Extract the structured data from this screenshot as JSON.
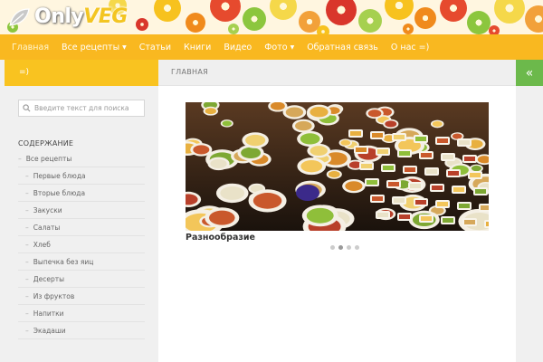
{
  "site": {
    "logo_part1": "Only",
    "logo_part2": "VEG"
  },
  "nav": {
    "items": [
      {
        "label": "Главная",
        "has_dropdown": false,
        "active": true
      },
      {
        "label": "Все рецепты",
        "has_dropdown": true,
        "active": false
      },
      {
        "label": "Статьи",
        "has_dropdown": false,
        "active": false
      },
      {
        "label": "Книги",
        "has_dropdown": false,
        "active": false
      },
      {
        "label": "Видео",
        "has_dropdown": false,
        "active": false
      },
      {
        "label": "Фото",
        "has_dropdown": true,
        "active": false
      },
      {
        "label": "Обратная связь",
        "has_dropdown": false,
        "active": false
      },
      {
        "label": "О нас =)",
        "has_dropdown": false,
        "active": false
      }
    ]
  },
  "sidebar": {
    "header": "=)",
    "search_placeholder": "Введите текст для поиска",
    "section_title": "СОДЕРЖАНИЕ",
    "categories": [
      {
        "label": "Все рецепты",
        "sub": false
      },
      {
        "label": "Первые блюда",
        "sub": true
      },
      {
        "label": "Вторые блюда",
        "sub": true
      },
      {
        "label": "Закуски",
        "sub": true
      },
      {
        "label": "Салаты",
        "sub": true
      },
      {
        "label": "Хлеб",
        "sub": true
      },
      {
        "label": "Выпечка без яиц",
        "sub": true
      },
      {
        "label": "Десерты",
        "sub": true
      },
      {
        "label": "Из фруктов",
        "sub": true
      },
      {
        "label": "Напитки",
        "sub": true
      },
      {
        "label": "Экадаши",
        "sub": true
      }
    ]
  },
  "main": {
    "page_title": "ГЛАВНАЯ",
    "slide_caption": "Разнообразие",
    "slide_count": 4,
    "active_slide": 1
  },
  "colors": {
    "nav_bg": "#f9b820",
    "sidebar_head": "#f9c320",
    "collapse_btn": "#6cb94b"
  },
  "icons": {
    "collapse": "double-chevron-left-icon",
    "search": "search-icon"
  }
}
